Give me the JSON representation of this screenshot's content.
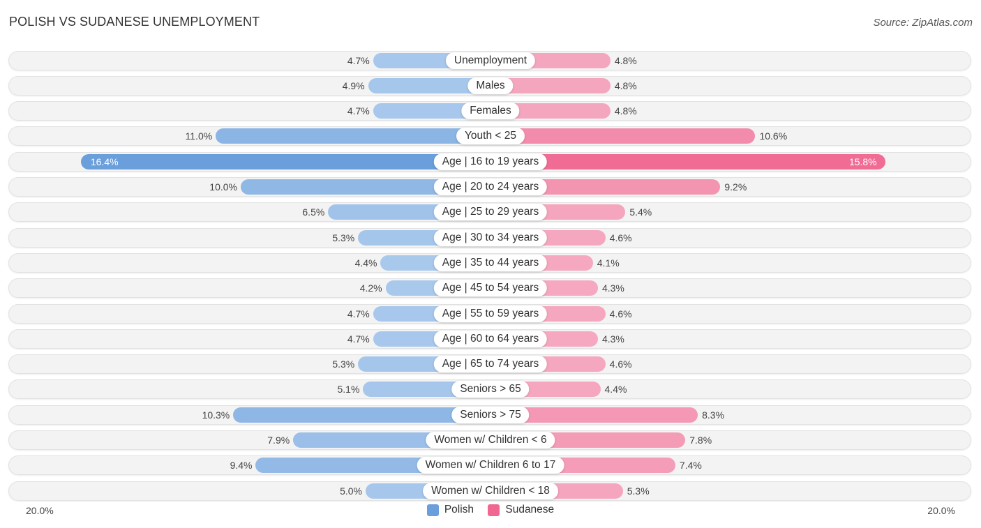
{
  "header": {
    "title": "POLISH VS SUDANESE UNEMPLOYMENT",
    "source": "Source: ZipAtlas.com"
  },
  "colors": {
    "polish": "#6a9fdb",
    "polish_light": "#a8c8ec",
    "sudanese": "#f06892",
    "sudanese_light": "#f5a8c0"
  },
  "chart_data": {
    "type": "bar",
    "orientation": "horizontal-diverging",
    "title": "POLISH VS SUDANESE UNEMPLOYMENT",
    "xlabel": "",
    "ylabel": "",
    "xlim": [
      0,
      20.0
    ],
    "axis_min_label": "20.0%",
    "axis_max_label": "20.0%",
    "legend_position": "bottom-center",
    "categories": [
      "Unemployment",
      "Males",
      "Females",
      "Youth < 25",
      "Age | 16 to 19 years",
      "Age | 20 to 24 years",
      "Age | 25 to 29 years",
      "Age | 30 to 34 years",
      "Age | 35 to 44 years",
      "Age | 45 to 54 years",
      "Age | 55 to 59 years",
      "Age | 60 to 64 years",
      "Age | 65 to 74 years",
      "Seniors > 65",
      "Seniors > 75",
      "Women w/ Children < 6",
      "Women w/ Children 6 to 17",
      "Women w/ Children < 18"
    ],
    "series": [
      {
        "name": "Polish",
        "side": "left",
        "values": [
          4.7,
          4.9,
          4.7,
          11.0,
          16.4,
          10.0,
          6.5,
          5.3,
          4.4,
          4.2,
          4.7,
          4.7,
          5.3,
          5.1,
          10.3,
          7.9,
          9.4,
          5.0
        ],
        "labels": [
          "4.7%",
          "4.9%",
          "4.7%",
          "11.0%",
          "16.4%",
          "10.0%",
          "6.5%",
          "5.3%",
          "4.4%",
          "4.2%",
          "4.7%",
          "4.7%",
          "5.3%",
          "5.1%",
          "10.3%",
          "7.9%",
          "9.4%",
          "5.0%"
        ]
      },
      {
        "name": "Sudanese",
        "side": "right",
        "values": [
          4.8,
          4.8,
          4.8,
          10.6,
          15.8,
          9.2,
          5.4,
          4.6,
          4.1,
          4.3,
          4.6,
          4.3,
          4.6,
          4.4,
          8.3,
          7.8,
          7.4,
          5.3
        ],
        "labels": [
          "4.8%",
          "4.8%",
          "4.8%",
          "10.6%",
          "15.8%",
          "9.2%",
          "5.4%",
          "4.6%",
          "4.1%",
          "4.3%",
          "4.6%",
          "4.3%",
          "4.6%",
          "4.4%",
          "8.3%",
          "7.8%",
          "7.4%",
          "5.3%"
        ]
      }
    ]
  },
  "legend": {
    "items": [
      {
        "label": "Polish"
      },
      {
        "label": "Sudanese"
      }
    ]
  }
}
